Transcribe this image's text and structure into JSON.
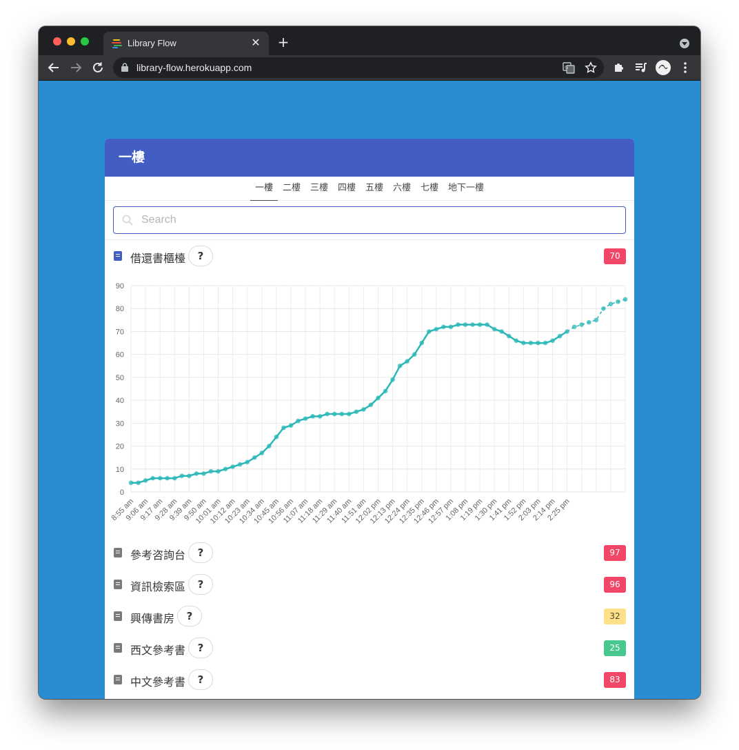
{
  "browser": {
    "tab_title": "Library Flow",
    "url": "library-flow.herokuapp.com"
  },
  "page": {
    "title": "一樓",
    "floor_tabs": [
      "一樓",
      "二樓",
      "三樓",
      "四樓",
      "五樓",
      "六樓",
      "七樓",
      "地下一樓"
    ],
    "active_tab": "一樓",
    "search_placeholder": "Search",
    "colors": {
      "header": "#425ec2",
      "page_bg": "#2a8dd1",
      "red": "#f14668",
      "yellow": "#ffe08a",
      "green": "#48c78e"
    },
    "locations": [
      {
        "name": "借還書櫃檯",
        "help": "?",
        "count": "70",
        "status": "red",
        "icon": "book-icon",
        "expanded": true
      },
      {
        "name": "參考咨詢台",
        "help": "?",
        "count": "97",
        "status": "red",
        "icon": "book-icon"
      },
      {
        "name": "資訊檢索區",
        "help": "?",
        "count": "96",
        "status": "red",
        "icon": "book-icon"
      },
      {
        "name": "興傳書房",
        "help": "?",
        "count": "32",
        "status": "yellow",
        "icon": "book-icon"
      },
      {
        "name": "西文參考書",
        "help": "?",
        "count": "25",
        "status": "green",
        "icon": "book-icon"
      },
      {
        "name": "中文參考書",
        "help": "?",
        "count": "83",
        "status": "red",
        "icon": "book-icon"
      }
    ]
  },
  "chart_data": {
    "type": "line",
    "title": "",
    "xlabel": "",
    "ylabel": "",
    "ylim": [
      0,
      90
    ],
    "yticks": [
      0,
      10,
      20,
      30,
      40,
      50,
      60,
      70,
      80,
      90
    ],
    "grid": true,
    "line_color": "#2bb7b7",
    "xtick_labels": [
      "8:55 am",
      "9:06 am",
      "9:17 am",
      "9:28 am",
      "9:39 am",
      "9:50 am",
      "10:01 am",
      "10:12 am",
      "10:23 am",
      "10:34 am",
      "10:45 am",
      "10:56 am",
      "11:07 am",
      "11:18 am",
      "11:29 am",
      "11:40 am",
      "11:51 am",
      "12:02 pm",
      "12:13 pm",
      "12:24 pm",
      "12:35 pm",
      "12:46 pm",
      "12:57 pm",
      "1:08 pm",
      "1:19 pm",
      "1:30 pm",
      "1:41 pm",
      "1:52 pm",
      "2:03 pm",
      "2:14 pm",
      "2:25 pm"
    ],
    "series": [
      {
        "values": [
          4,
          4,
          5,
          6,
          6,
          6,
          6,
          7,
          7,
          8,
          8,
          9,
          9,
          10,
          11,
          12,
          13,
          15,
          17,
          20,
          24,
          28,
          29,
          31,
          32,
          33,
          33,
          34,
          34,
          34,
          34,
          35,
          36,
          38,
          41,
          44,
          49,
          55,
          57,
          60,
          65,
          70,
          71,
          72,
          72,
          73,
          73,
          73,
          73,
          73,
          71,
          70,
          68,
          66,
          65,
          65,
          65,
          65,
          66,
          68,
          70
        ]
      },
      {
        "style": "dashed",
        "start_index": 60,
        "values": [
          70,
          72,
          73,
          74,
          75,
          80,
          82,
          83,
          84
        ]
      }
    ]
  }
}
